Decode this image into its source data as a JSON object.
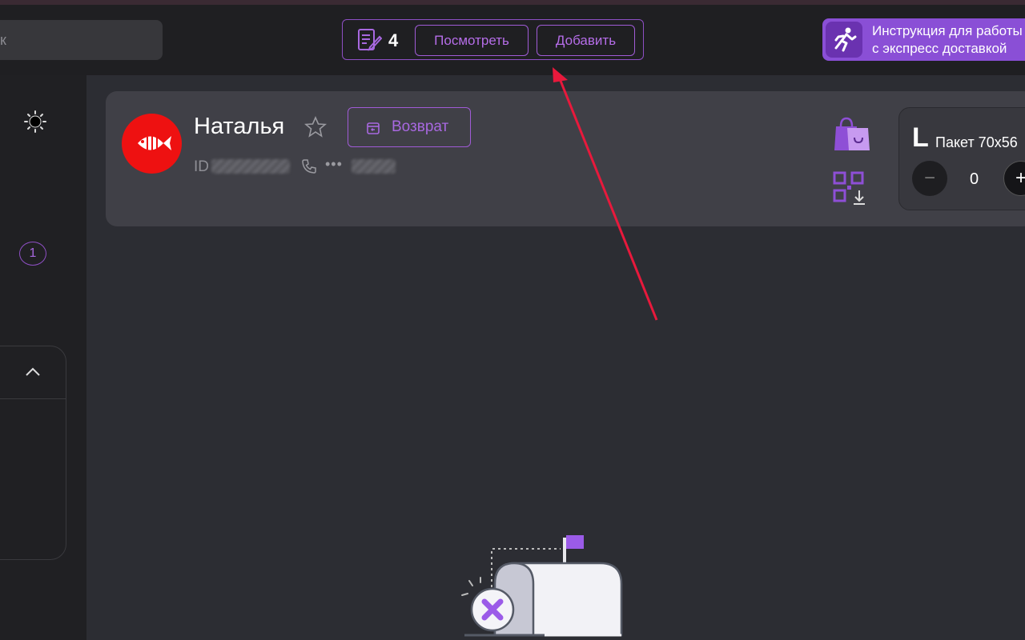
{
  "search": {
    "placeholder_fragment": "к"
  },
  "cart": {
    "count": "4",
    "view_label": "Посмотреть",
    "add_label": "Добавить"
  },
  "instruction": {
    "line1": "Инструкция для работы",
    "line2": "с экспресс доставкой"
  },
  "sidebar": {
    "badge_count": "1"
  },
  "customer": {
    "name": "Наталья",
    "return_label": "Возврат",
    "id_label": "ID",
    "phone_mask": "•••"
  },
  "package": {
    "size": "L",
    "name": "Пакет 70x56",
    "quantity": "0",
    "minus_label": "−",
    "plus_label": "+"
  },
  "colors": {
    "accent": "#a868e0",
    "brand_red": "#ee1111",
    "arrow": "#e8193c"
  },
  "icons": [
    "document-icon",
    "running-man-icon",
    "sun-icon",
    "chevron-up-icon",
    "fish-logo-icon",
    "star-icon",
    "return-icon",
    "phone-icon",
    "shopping-bag-icon",
    "qr-download-icon",
    "empty-mailbox-illustration"
  ]
}
